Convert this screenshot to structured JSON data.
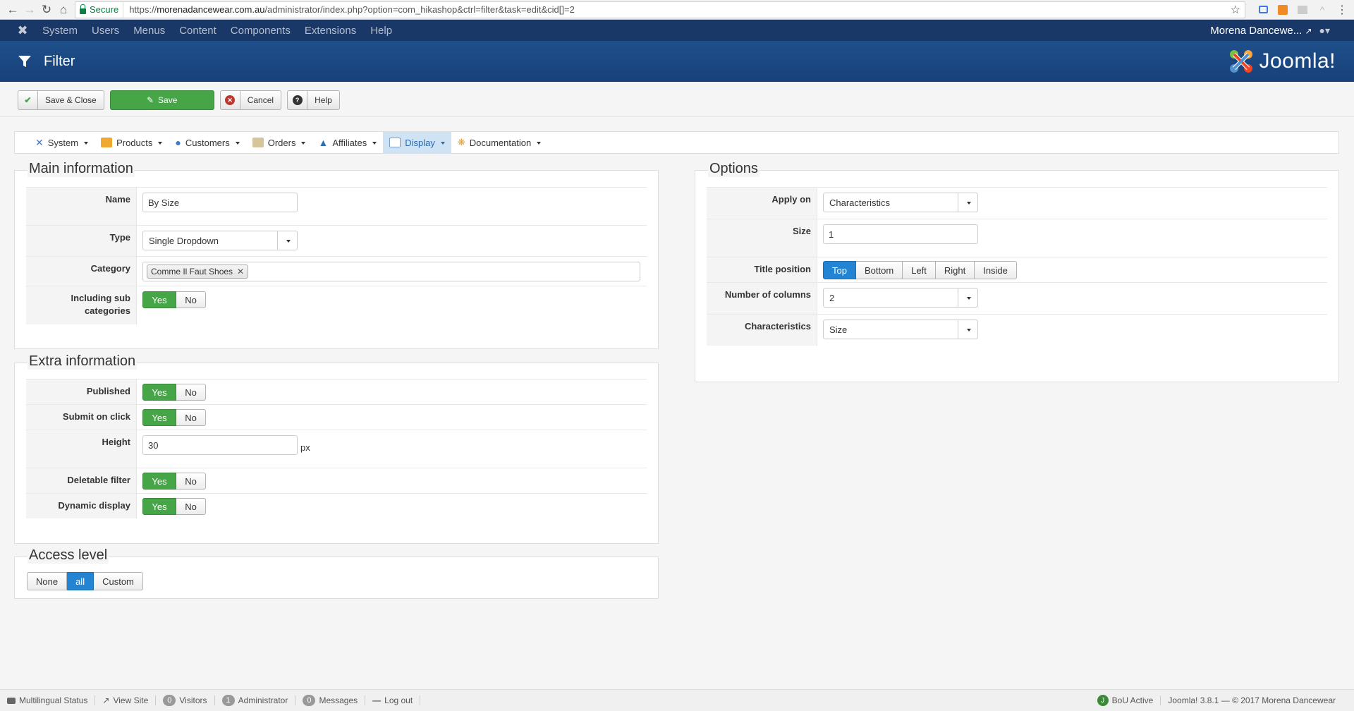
{
  "browser": {
    "secure_label": "Secure",
    "url_prefix": "https://",
    "url_host": "morenadancewear.com.au",
    "url_path": "/administrator/index.php?option=com_hikashop&ctrl=filter&task=edit&cid[]=2"
  },
  "topnav": {
    "items": [
      "System",
      "Users",
      "Menus",
      "Content",
      "Components",
      "Extensions",
      "Help"
    ],
    "site_user": "Morena Dancewe..."
  },
  "header": {
    "title": "Filter",
    "brand": "Joomla!"
  },
  "toolbar": {
    "save_close": "Save & Close",
    "save": "Save",
    "cancel": "Cancel",
    "help": "Help"
  },
  "hikamenu": {
    "items": [
      "System",
      "Products",
      "Customers",
      "Orders",
      "Affiliates",
      "Display",
      "Documentation"
    ],
    "active": "Display"
  },
  "main_info": {
    "legend": "Main information",
    "name_label": "Name",
    "name_value": "By Size",
    "type_label": "Type",
    "type_value": "Single Dropdown",
    "category_label": "Category",
    "category_chip": "Comme Il Faut Shoes",
    "sub_label": "Including sub categories",
    "yes": "Yes",
    "no": "No"
  },
  "extra_info": {
    "legend": "Extra information",
    "published_label": "Published",
    "submit_label": "Submit on click",
    "height_label": "Height",
    "height_value": "30",
    "height_unit": "px",
    "deletable_label": "Deletable filter",
    "dynamic_label": "Dynamic display",
    "yes": "Yes",
    "no": "No"
  },
  "access": {
    "legend": "Access level",
    "options": [
      "None",
      "all",
      "Custom"
    ],
    "selected": "all"
  },
  "options": {
    "legend": "Options",
    "apply_label": "Apply on",
    "apply_value": "Characteristics",
    "size_label": "Size",
    "size_value": "1",
    "title_pos_label": "Title position",
    "title_positions": [
      "Top",
      "Bottom",
      "Left",
      "Right",
      "Inside"
    ],
    "title_pos_selected": "Top",
    "columns_label": "Number of columns",
    "columns_value": "2",
    "char_label": "Characteristics",
    "char_value": "Size"
  },
  "statusbar": {
    "multilingual": "Multilingual Status",
    "view_site": "View Site",
    "visitors_count": "0",
    "visitors": "Visitors",
    "admin_count": "1",
    "admin": "Administrator",
    "messages_count": "0",
    "messages": "Messages",
    "logout": "Log out",
    "bou": "BoU Active",
    "version": "Joomla! 3.8.1 — © 2017 Morena Dancewear"
  },
  "colors": {
    "nav_dark": "#1a3867",
    "header_blue": "#1d4b83",
    "green": "#46a546",
    "blue_active": "#2384d3"
  }
}
